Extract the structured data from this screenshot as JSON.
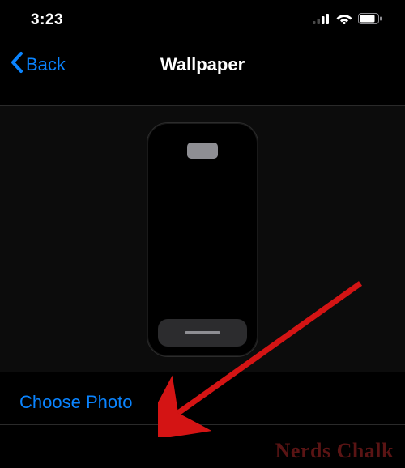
{
  "statusBar": {
    "time": "3:23"
  },
  "nav": {
    "backLabel": "Back",
    "title": "Wallpaper"
  },
  "actions": {
    "choosePhoto": "Choose Photo"
  },
  "watermark": "Nerds Chalk"
}
